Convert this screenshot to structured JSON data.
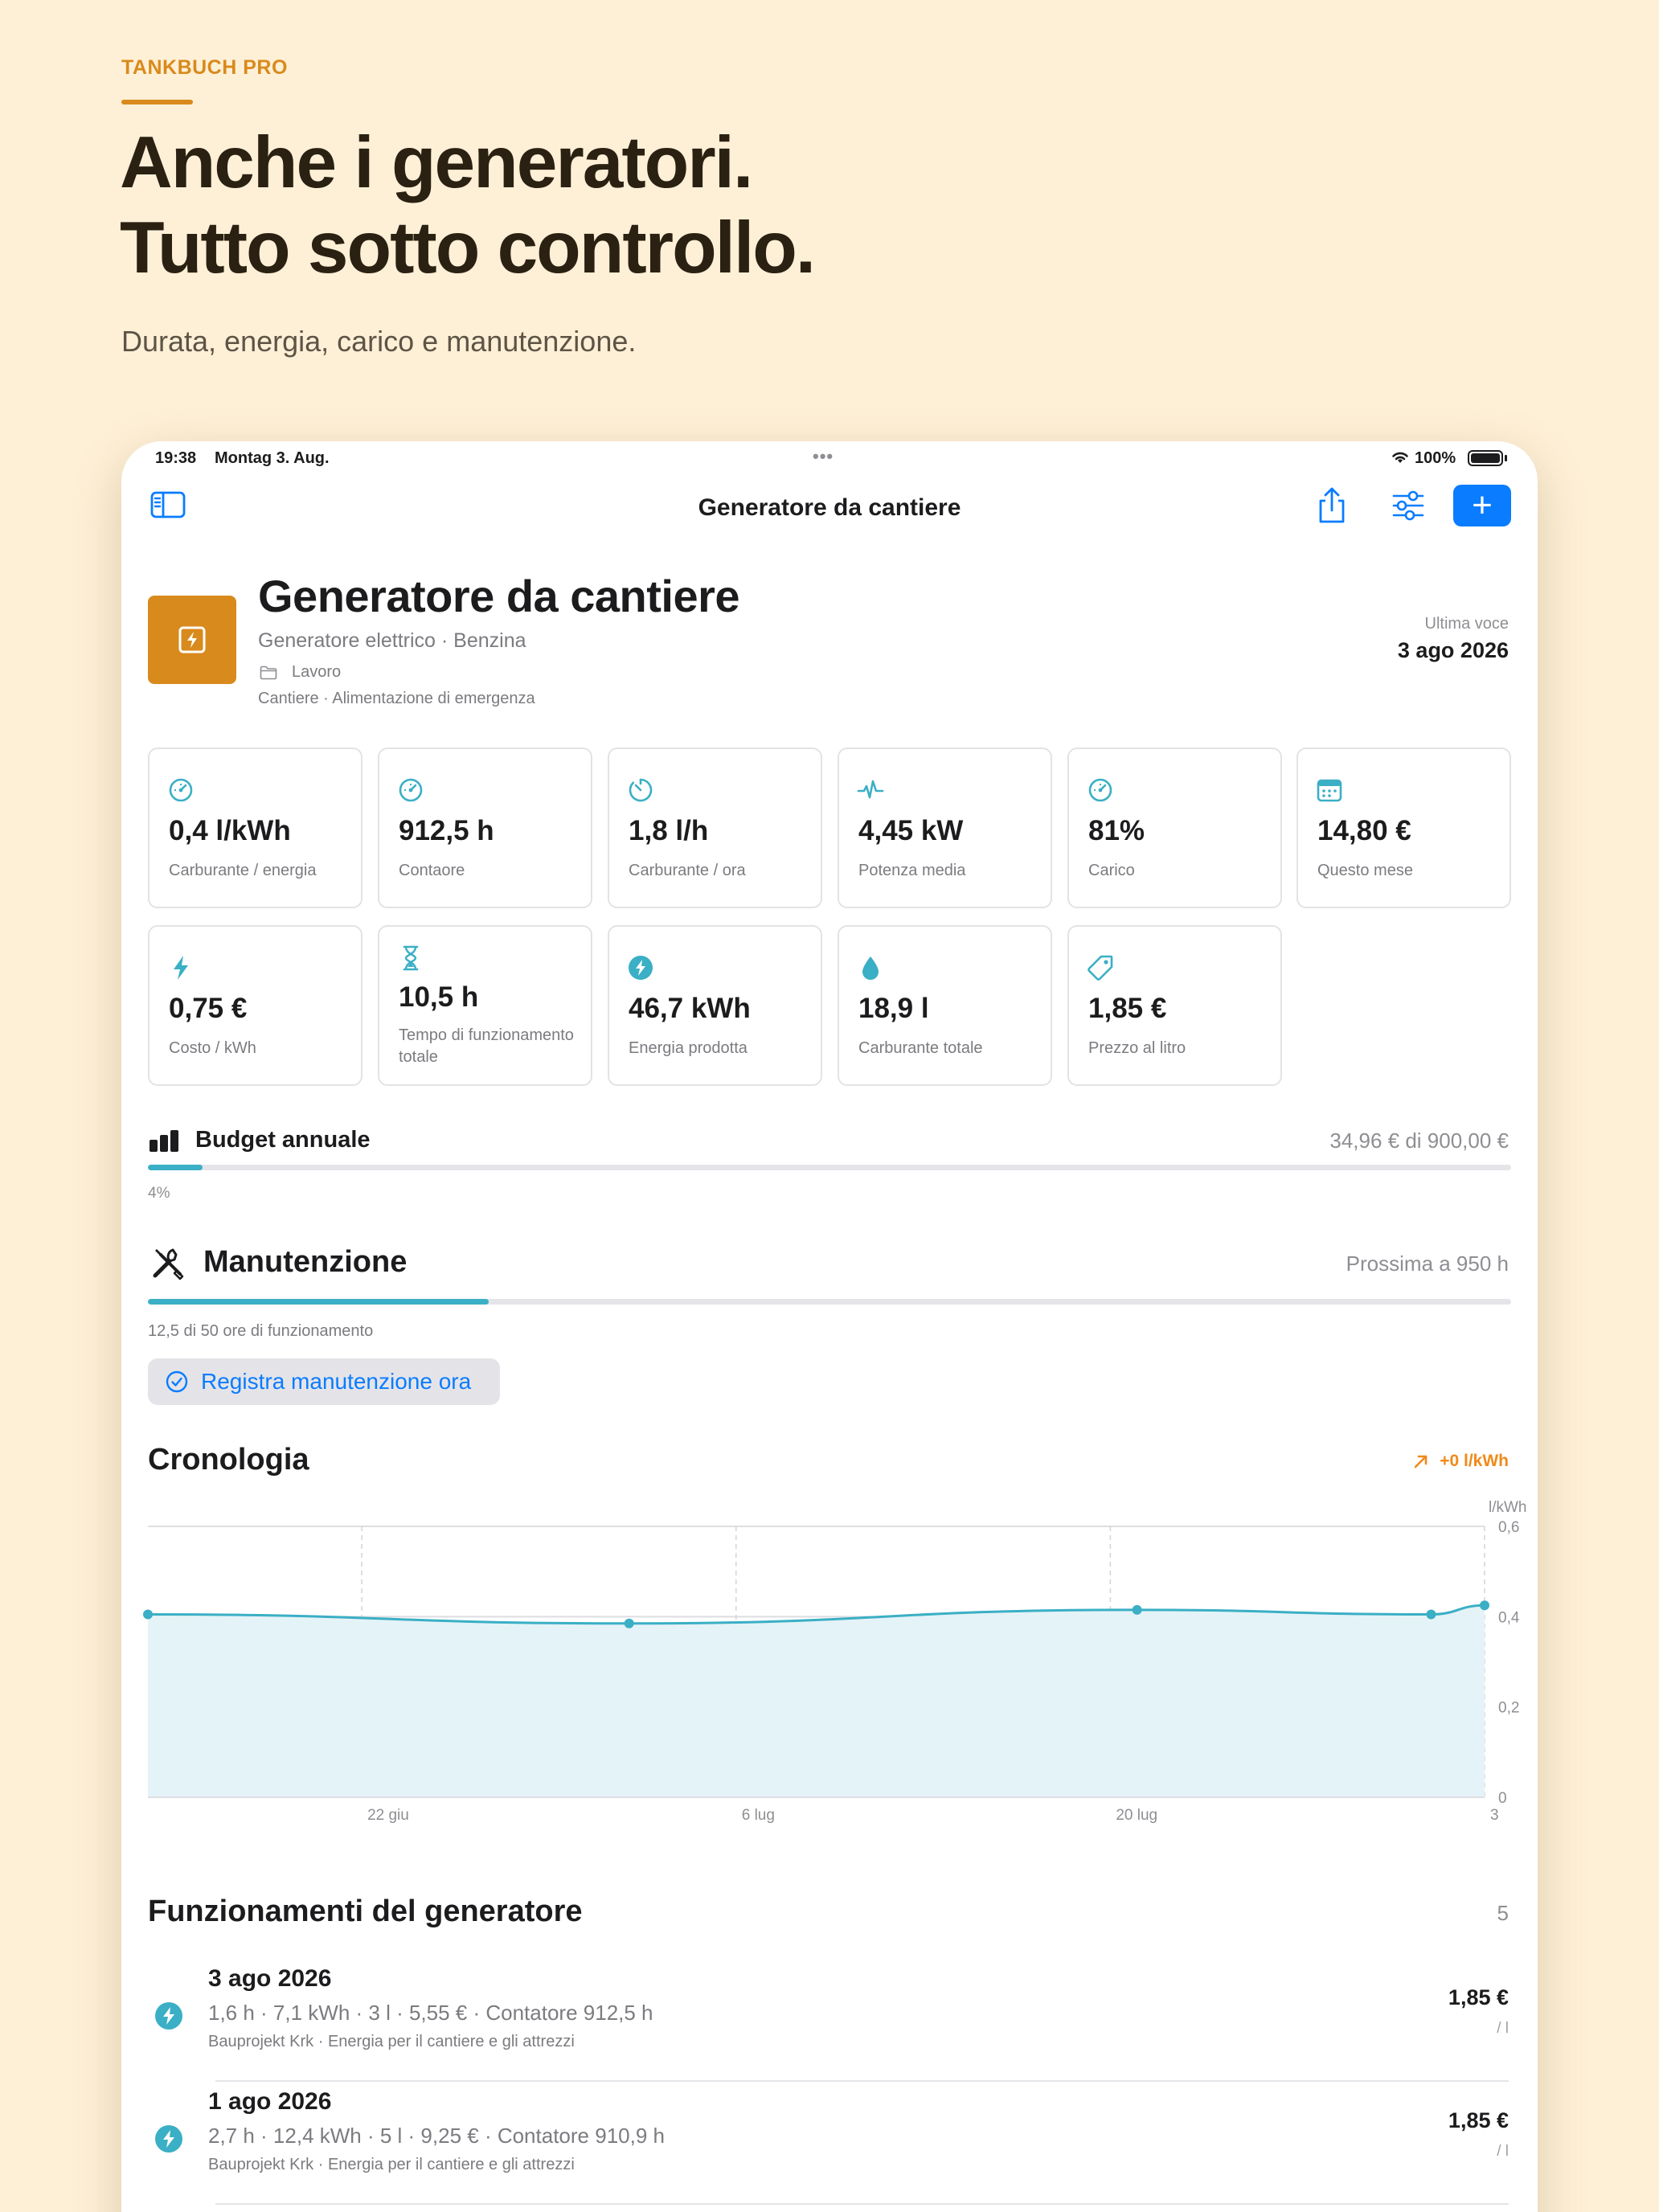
{
  "marketing": {
    "eyebrow": "TANKBUCH PRO",
    "headline_line1": "Anche i generatori.",
    "headline_line2": "Tutto sotto controllo.",
    "subline": "Durata, energia, carico e manutenzione."
  },
  "status_bar": {
    "time": "19:38",
    "date": "Montag 3. Aug.",
    "battery": "100%"
  },
  "nav": {
    "title": "Generatore da cantiere",
    "add_label": "+"
  },
  "vehicle": {
    "name": "Generatore da cantiere",
    "type": "Generatore elettrico · Benzina",
    "folder": "Lavoro",
    "tags": "Cantiere · Alimentazione di emergenza",
    "last_entry_label": "Ultima voce",
    "last_entry_date": "3 ago 2026",
    "icon": "generator-bolt-icon",
    "accent_color": "#D98A1C"
  },
  "stats": [
    {
      "value": "0,4 l/kWh",
      "label": "Carburante / energia",
      "icon": "gauge-icon"
    },
    {
      "value": "912,5 h",
      "label": "Contaore",
      "icon": "gauge-icon"
    },
    {
      "value": "1,8 l/h",
      "label": "Carburante / ora",
      "icon": "timer-icon"
    },
    {
      "value": "4,45 kW",
      "label": "Potenza media",
      "icon": "waveform-icon"
    },
    {
      "value": "81%",
      "label": "Carico",
      "icon": "gauge-icon"
    },
    {
      "value": "14,80 €",
      "label": "Questo mese",
      "icon": "calendar-icon"
    },
    {
      "value": "0,75 €",
      "label": "Costo / kWh",
      "icon": "bolt-icon"
    },
    {
      "value": "10,5 h",
      "label": "Tempo di funzionamento totale",
      "icon": "hourglass-icon"
    },
    {
      "value": "46,7 kWh",
      "label": "Energia prodotta",
      "icon": "bolt-circle-icon"
    },
    {
      "value": "18,9 l",
      "label": "Carburante totale",
      "icon": "drop-icon"
    },
    {
      "value": "1,85 €",
      "label": "Prezzo al litro",
      "icon": "tag-icon"
    }
  ],
  "budget": {
    "title": "Budget annuale",
    "amount": "34,96 € di 900,00 €",
    "percent_label": "4%",
    "progress": 0.04
  },
  "maintenance": {
    "title": "Manutenzione",
    "next": "Prossima a 950 h",
    "hours_text": "12,5 di 50 ore di funzionamento",
    "button_label": "Registra manutenzione ora",
    "progress": 0.25
  },
  "chronology": {
    "title": "Cronologia",
    "trend": "+0 l/kWh",
    "trend_color": "#F08A1A",
    "line_color": "#3AAFC5"
  },
  "chart_data": {
    "type": "area",
    "ylabel": "l/kWh",
    "ylim": [
      0,
      0.6
    ],
    "y_ticks": [
      "0,6",
      "0,4",
      "0,2",
      "0"
    ],
    "x_ticks": [
      "22 giu",
      "6 lug",
      "20 lug",
      "3"
    ],
    "x": [
      "14 giu",
      "2 lug",
      "21 lug",
      "1 ago",
      "3 ago"
    ],
    "values": [
      0.405,
      0.385,
      0.415,
      0.405,
      0.425
    ],
    "grid": true
  },
  "runs": {
    "title": "Funzionamenti del generatore",
    "count": "5",
    "items": [
      {
        "date": "3 ago 2026",
        "details": "1,6 h · 7,1 kWh · 3 l · 5,55 € · Contatore 912,5 h",
        "note": "Bauprojekt Krk · Energia per il cantiere e gli attrezzi",
        "price": "1,85 €",
        "unit": "/ l"
      },
      {
        "date": "1 ago 2026",
        "details": "2,7 h · 12,4 kWh · 5 l · 9,25 € · Contatore 910,9 h",
        "note": "Bauprojekt Krk · Energia per il cantiere e gli attrezzi",
        "price": "1,85 €",
        "unit": "/ l"
      }
    ]
  }
}
